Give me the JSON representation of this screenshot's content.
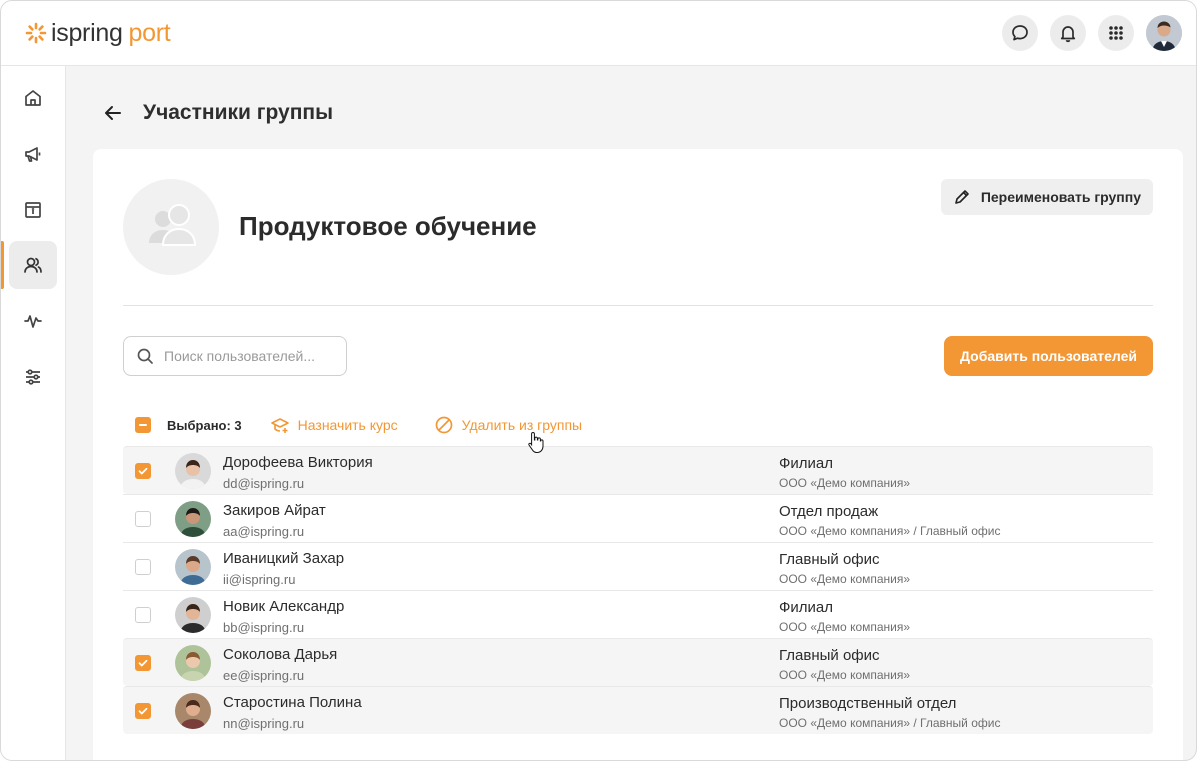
{
  "app": {
    "brand_main": "ispring",
    "brand_sub": "port",
    "accent": "#f29734"
  },
  "topbar": {
    "icons": [
      "chat-icon",
      "bell-icon",
      "apps-grid-icon",
      "user-avatar"
    ]
  },
  "sidebar": {
    "items": [
      {
        "icon": "home-icon"
      },
      {
        "icon": "megaphone-icon"
      },
      {
        "icon": "catalog-icon"
      },
      {
        "icon": "users-icon",
        "active": true
      },
      {
        "icon": "activity-icon"
      },
      {
        "icon": "settings-sliders-icon"
      }
    ]
  },
  "header": {
    "title": "Участники группы"
  },
  "group": {
    "name": "Продуктовое обучение",
    "rename_label": "Переименовать группу"
  },
  "search": {
    "placeholder": "Поиск пользователей...",
    "value": ""
  },
  "add_button": "Добавить пользователей",
  "toolbar": {
    "selected_label": "Выбрано: 3",
    "assign_label": "Назначить курс",
    "remove_label": "Удалить из группы"
  },
  "users": [
    {
      "name": "Дорофеева Виктория",
      "email": "dd@ispring.ru",
      "dept": "Филиал",
      "org": "ООО «Демо компания»",
      "checked": true
    },
    {
      "name": "Закиров Айрат",
      "email": "aa@ispring.ru",
      "dept": "Отдел продаж",
      "org": "ООО «Демо компания» / Главный офис",
      "checked": false
    },
    {
      "name": "Иваницкий Захар",
      "email": "ii@ispring.ru",
      "dept": "Главный офис",
      "org": "ООО «Демо компания»",
      "checked": false
    },
    {
      "name": "Новик Александр",
      "email": "bb@ispring.ru",
      "dept": "Филиал",
      "org": "ООО «Демо компания»",
      "checked": false
    },
    {
      "name": "Соколова Дарья",
      "email": "ee@ispring.ru",
      "dept": "Главный офис",
      "org": "ООО «Демо компания»",
      "checked": true
    },
    {
      "name": "Старостина Полина",
      "email": "nn@ispring.ru",
      "dept": "Производственный отдел",
      "org": "ООО «Демо компания» / Главный офис",
      "checked": true
    }
  ]
}
